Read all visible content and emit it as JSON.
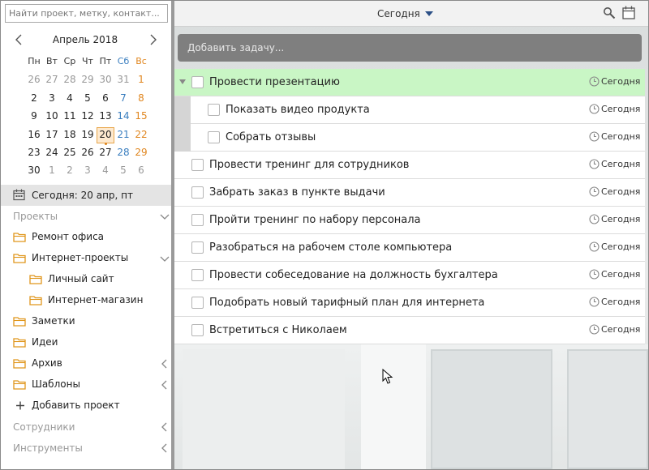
{
  "search": {
    "placeholder": "Найти проект, метку, контакт..."
  },
  "calendar": {
    "month_label": "Апрель 2018",
    "weekdays": [
      "Пн",
      "Вт",
      "Ср",
      "Чт",
      "Пт",
      "Сб",
      "Вс"
    ],
    "weeks": [
      [
        "26",
        "27",
        "28",
        "29",
        "30",
        "31",
        "1"
      ],
      [
        "2",
        "3",
        "4",
        "5",
        "6",
        "7",
        "8"
      ],
      [
        "9",
        "10",
        "11",
        "12",
        "13",
        "14",
        "15"
      ],
      [
        "16",
        "17",
        "18",
        "19",
        "20",
        "21",
        "22"
      ],
      [
        "23",
        "24",
        "25",
        "26",
        "27",
        "28",
        "29"
      ],
      [
        "30",
        "1",
        "2",
        "3",
        "4",
        "5",
        "6"
      ]
    ],
    "selected_day": "20"
  },
  "today_bar": {
    "label": "Сегодня: 20 апр, пт"
  },
  "sidebar": {
    "projects_header": "Проекты",
    "projects": [
      {
        "label": "Ремонт офиса"
      },
      {
        "label": "Интернет-проекты"
      },
      {
        "label": "Личный сайт"
      },
      {
        "label": "Интернет-магазин"
      },
      {
        "label": "Заметки"
      },
      {
        "label": "Идеи"
      },
      {
        "label": "Архив"
      },
      {
        "label": "Шаблоны"
      }
    ],
    "add_project": "Добавить проект",
    "staff_header": "Сотрудники",
    "tools_header": "Инструменты"
  },
  "topbar": {
    "view_label": "Сегодня"
  },
  "add_task": {
    "placeholder": "Добавить задачу..."
  },
  "tasks": [
    {
      "title": "Провести презентацию",
      "due": "Сегодня"
    },
    {
      "title": "Показать видео продукта",
      "due": "Сегодня"
    },
    {
      "title": "Собрать отзывы",
      "due": "Сегодня"
    },
    {
      "title": "Провести тренинг для сотрудников",
      "due": "Сегодня"
    },
    {
      "title": "Забрать заказ в пункте выдачи",
      "due": "Сегодня"
    },
    {
      "title": "Пройти тренинг по набору персонала",
      "due": "Сегодня"
    },
    {
      "title": "Разобраться на рабочем столе компьютера",
      "due": "Сегодня"
    },
    {
      "title": "Провести собеседование на должность бухгалтера",
      "due": "Сегодня"
    },
    {
      "title": "Подобрать новый тарифный план для интернета",
      "due": "Сегодня"
    },
    {
      "title": "Встретиться с Николаем",
      "due": "Сегодня"
    }
  ],
  "colors": {
    "accent_green": "#c9f6c5",
    "weekend_sun": "#e0861f",
    "weekend_sat": "#3a7ebf",
    "today_highlight": "#fde9cf"
  }
}
